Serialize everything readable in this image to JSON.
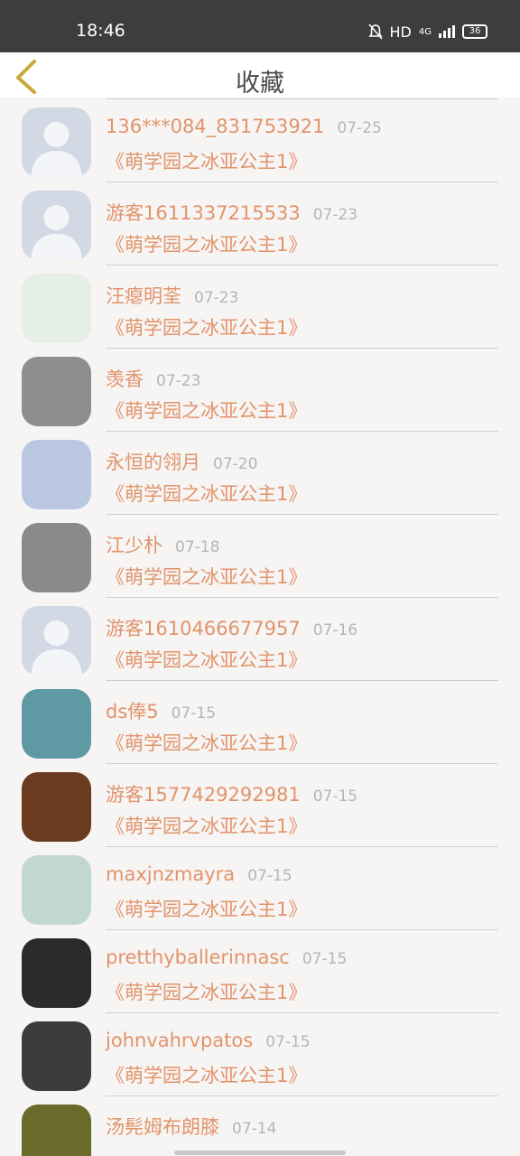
{
  "status_bar": {
    "time": "18:46",
    "hd": "HD",
    "network": "4G",
    "battery": "36"
  },
  "header": {
    "title": "收藏"
  },
  "items": [
    {
      "name": "136***084_831753921",
      "date": "07-25",
      "book": "《萌学园之冰亚公主1》",
      "avatar": "default",
      "color": "#d3d8e5"
    },
    {
      "name": "游客1611337215533",
      "date": "07-23",
      "book": "《萌学园之冰亚公主1》",
      "avatar": "default",
      "color": "#d3d8e5"
    },
    {
      "name": "汪瘪明荃",
      "date": "07-23",
      "book": "《萌学园之冰亚公主1》",
      "avatar": "photo",
      "color": "#e6eee8"
    },
    {
      "name": "羡香",
      "date": "07-23",
      "book": "《萌学园之冰亚公主1》",
      "avatar": "photo",
      "color": "#8d8f8c"
    },
    {
      "name": "永恒的翎月",
      "date": "07-20",
      "book": "《萌学园之冰亚公主1》",
      "avatar": "photo",
      "color": "#b9c7e0"
    },
    {
      "name": "江少朴",
      "date": "07-18",
      "book": "《萌学园之冰亚公主1》",
      "avatar": "photo",
      "color": "#8a8a8a"
    },
    {
      "name": "游客1610466677957",
      "date": "07-16",
      "book": "《萌学园之冰亚公主1》",
      "avatar": "default",
      "color": "#d3d8e5"
    },
    {
      "name": "ds俸5",
      "date": "07-15",
      "book": "《萌学园之冰亚公主1》",
      "avatar": "photo",
      "color": "#5f9aa4"
    },
    {
      "name": "游客1577429292981",
      "date": "07-15",
      "book": "《萌学园之冰亚公主1》",
      "avatar": "photo",
      "color": "#6b3b20"
    },
    {
      "name": "maxjnzmayra",
      "date": "07-15",
      "book": "《萌学园之冰亚公主1》",
      "avatar": "photo",
      "color": "#c3d7d2"
    },
    {
      "name": "pretthyballerinnasc",
      "date": "07-15",
      "book": "《萌学园之冰亚公主1》",
      "avatar": "photo",
      "color": "#2b2b2b"
    },
    {
      "name": "johnvahrvpatos",
      "date": "07-15",
      "book": "《萌学园之冰亚公主1》",
      "avatar": "photo",
      "color": "#3c3c3c"
    },
    {
      "name": "汤髡姆布朗膝",
      "date": "07-14",
      "book": "",
      "avatar": "photo",
      "color": "#6a6a2a"
    }
  ]
}
